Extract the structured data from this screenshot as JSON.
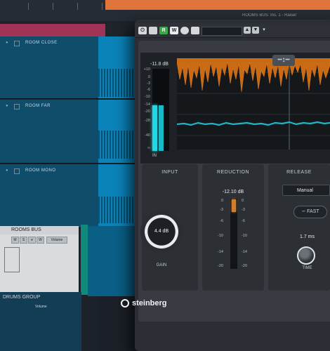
{
  "window": {
    "title": "ROOMS BUS: Ins. 1 - Raiser"
  },
  "project": {
    "tracks": [
      {
        "label": "ROOM CLOSE"
      },
      {
        "label": "ROOM FAR"
      },
      {
        "label": "ROOM MONO"
      }
    ],
    "selected_track": {
      "label": "ROOMS BUS",
      "button_labels": [
        "M",
        "S",
        "e",
        "W",
        "Volume"
      ]
    },
    "group_track": {
      "label": "DRUMS GROUP",
      "setting_label": "Volume"
    }
  },
  "plugin": {
    "toolbar": {
      "r_label": "R",
      "w_label": "W",
      "bypass_label": "⏻",
      "up_arrow": "▲",
      "down_arrow": "▼",
      "menu_arrow": "▾"
    },
    "input_meter": {
      "peak_label": "-11.8 dB",
      "scale": [
        "+10",
        "0",
        "-3",
        "-6",
        "-10",
        "-14",
        "-20",
        "-28",
        "-40",
        "∞"
      ],
      "label": "IN"
    },
    "sections": {
      "input": {
        "title": "INPUT",
        "knob_value": "4.4 dB",
        "knob_label": "GAIN"
      },
      "reduction": {
        "title": "REDUCTION",
        "value": "-12.10 dB",
        "scale_left": [
          "0",
          "-3",
          "-6",
          "-10",
          "-14",
          "-20"
        ],
        "scale_right": [
          "0",
          "-3",
          "-6",
          "-10",
          "-14",
          "-20"
        ],
        "level": 0.18
      },
      "release": {
        "title": "RELEASE",
        "mode": "Manual",
        "fast_label": "FAST",
        "time_value": "1.7 ms",
        "time_label": "TIME"
      }
    },
    "brand": "steinberg",
    "colors": {
      "waveform_orange": "#e07a1c",
      "meter_cyan": "#22d8e6",
      "reduction_orange": "#d07f2a"
    }
  }
}
